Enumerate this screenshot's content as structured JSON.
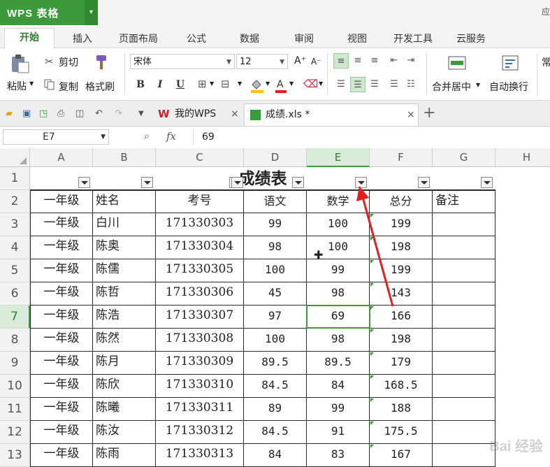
{
  "app": {
    "logo_text": "WPS 表格",
    "logo_dropdown": "▾",
    "top_right": "应"
  },
  "menu": {
    "tabs": [
      "开始",
      "插入",
      "页面布局",
      "公式",
      "数据",
      "审阅",
      "视图",
      "开发工具",
      "云服务"
    ],
    "active": "开始"
  },
  "ribbon": {
    "paste_label": "粘贴",
    "cut_label": "剪切",
    "copy_label": "复制",
    "format_painter_label": "格式刷",
    "font_name": "宋体",
    "font_size": "12",
    "grow_font": "A⁺",
    "shrink_font": "A⁻",
    "bold": "B",
    "italic": "I",
    "underline": "U",
    "merge_label": "合并居中",
    "wrap_label": "自动换行",
    "right_edge": "常"
  },
  "quickbar": {
    "doc_tabs": [
      {
        "label": "我的WPS",
        "close": "×"
      },
      {
        "label": "成绩.xls *",
        "close": "×"
      }
    ],
    "new_tab": "+"
  },
  "formula_bar": {
    "cell_ref": "E7",
    "fx_label": "fx",
    "value": "69"
  },
  "sheet": {
    "columns": [
      "A",
      "B",
      "C",
      "D",
      "E",
      "F",
      "G",
      "H"
    ],
    "selected_column": "E",
    "selected_row": "7",
    "title": "成绩表",
    "headers": [
      "一年级",
      "姓名",
      "考号",
      "语文",
      "数学",
      "总分",
      "备注"
    ],
    "rows": [
      {
        "num": "3",
        "cells": [
          "一年级",
          "白川",
          "171330303",
          "99",
          "100",
          "199",
          ""
        ]
      },
      {
        "num": "4",
        "cells": [
          "一年级",
          "陈奥",
          "171330304",
          "98",
          "100",
          "198",
          ""
        ]
      },
      {
        "num": "5",
        "cells": [
          "一年级",
          "陈儒",
          "171330305",
          "100",
          "99",
          "199",
          ""
        ]
      },
      {
        "num": "6",
        "cells": [
          "一年级",
          "陈哲",
          "171330306",
          "45",
          "98",
          "143",
          ""
        ]
      },
      {
        "num": "7",
        "cells": [
          "一年级",
          "陈浩",
          "171330307",
          "97",
          "69",
          "166",
          ""
        ]
      },
      {
        "num": "8",
        "cells": [
          "一年级",
          "陈然",
          "171330308",
          "100",
          "98",
          "198",
          ""
        ]
      },
      {
        "num": "9",
        "cells": [
          "一年级",
          "陈月",
          "171330309",
          "89.5",
          "89.5",
          "179",
          ""
        ]
      },
      {
        "num": "10",
        "cells": [
          "一年级",
          "陈欣",
          "171330310",
          "84.5",
          "84",
          "168.5",
          ""
        ]
      },
      {
        "num": "11",
        "cells": [
          "一年级",
          "陈曦",
          "171330311",
          "89",
          "99",
          "188",
          ""
        ]
      },
      {
        "num": "12",
        "cells": [
          "一年级",
          "陈汝",
          "171330312",
          "84.5",
          "91",
          "175.5",
          ""
        ]
      },
      {
        "num": "13",
        "cells": [
          "一年级",
          "陈雨",
          "171330313",
          "84",
          "83",
          "167",
          ""
        ]
      }
    ],
    "watermark": "Bai 经验"
  },
  "colors": {
    "accent": "#3a9a3a",
    "annotation_arrow": "#e02020"
  }
}
